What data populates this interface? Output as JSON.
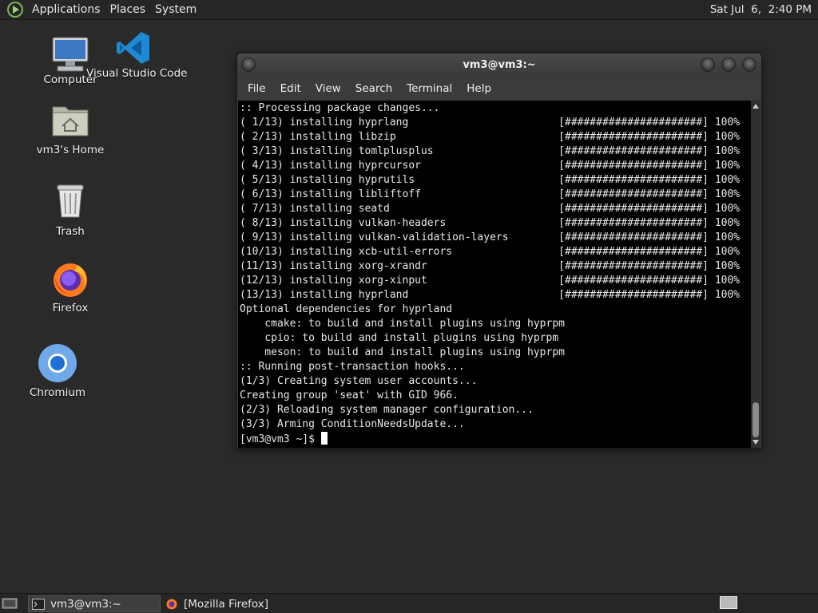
{
  "top_panel": {
    "menus": [
      "Applications",
      "Places",
      "System"
    ],
    "clock": "Sat Jul  6,  2:40 PM"
  },
  "desktop": {
    "icons": [
      {
        "label": "Computer",
        "icon": "computer-icon"
      },
      {
        "label": "Visual Studio Code",
        "icon": "vscode-icon"
      },
      {
        "label": "vm3's Home",
        "icon": "home-folder-icon"
      },
      {
        "label": "Trash",
        "icon": "trash-icon"
      },
      {
        "label": "Firefox",
        "icon": "firefox-icon"
      },
      {
        "label": "Chromium",
        "icon": "chromium-icon"
      }
    ]
  },
  "terminal": {
    "title": "vm3@vm3:~",
    "menus": [
      "File",
      "Edit",
      "View",
      "Search",
      "Terminal",
      "Help"
    ],
    "lines": [
      ":: Processing package changes...",
      "( 1/13) installing hyprlang                        [######################] 100%",
      "( 2/13) installing libzip                          [######################] 100%",
      "( 3/13) installing tomlplusplus                    [######################] 100%",
      "( 4/13) installing hyprcursor                      [######################] 100%",
      "( 5/13) installing hyprutils                       [######################] 100%",
      "( 6/13) installing libliftoff                      [######################] 100%",
      "( 7/13) installing seatd                           [######################] 100%",
      "( 8/13) installing vulkan-headers                  [######################] 100%",
      "( 9/13) installing vulkan-validation-layers        [######################] 100%",
      "(10/13) installing xcb-util-errors                 [######################] 100%",
      "(11/13) installing xorg-xrandr                     [######################] 100%",
      "(12/13) installing xorg-xinput                     [######################] 100%",
      "(13/13) installing hyprland                        [######################] 100%",
      "Optional dependencies for hyprland",
      "    cmake: to build and install plugins using hyprpm",
      "    cpio: to build and install plugins using hyprpm",
      "    meson: to build and install plugins using hyprpm",
      ":: Running post-transaction hooks...",
      "(1/3) Creating system user accounts...",
      "Creating group 'seat' with GID 966.",
      "(2/3) Reloading system manager configuration...",
      "(3/3) Arming ConditionNeedsUpdate..."
    ],
    "prompt": "[vm3@vm3 ~]$ "
  },
  "taskbar": {
    "tasks": [
      {
        "label": "vm3@vm3:~",
        "icon": "terminal-icon",
        "active": true
      },
      {
        "label": "[Mozilla Firefox]",
        "icon": "firefox-icon",
        "active": false
      }
    ]
  }
}
